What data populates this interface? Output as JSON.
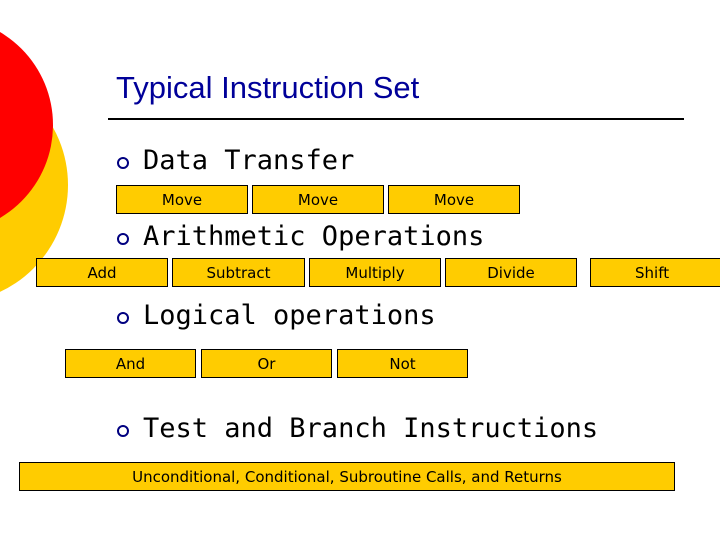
{
  "slide": {
    "title": "Typical Instruction Set",
    "accent_colors": {
      "title": "#000099",
      "box_fill": "#FFCC00",
      "decor_red": "#FF0000",
      "decor_yellow": "#FFCC00",
      "bullet": "#000080"
    }
  },
  "sections": [
    {
      "heading": "Data Transfer",
      "bullet_icon": "hollow-circle-bullet",
      "items": [
        "Move",
        "Move",
        "Move"
      ]
    },
    {
      "heading": "Arithmetic Operations",
      "bullet_icon": "hollow-circle-bullet",
      "items": [
        "Add",
        "Subtract",
        "Multiply",
        "Divide",
        "Shift"
      ]
    },
    {
      "heading": "Logical operations",
      "bullet_icon": "hollow-circle-bullet",
      "items": [
        "And",
        "Or",
        "Not"
      ]
    },
    {
      "heading": "Test and Branch Instructions",
      "bullet_icon": "hollow-circle-bullet",
      "items": [
        "Unconditional, Conditional, Subroutine Calls, and Returns"
      ]
    }
  ]
}
